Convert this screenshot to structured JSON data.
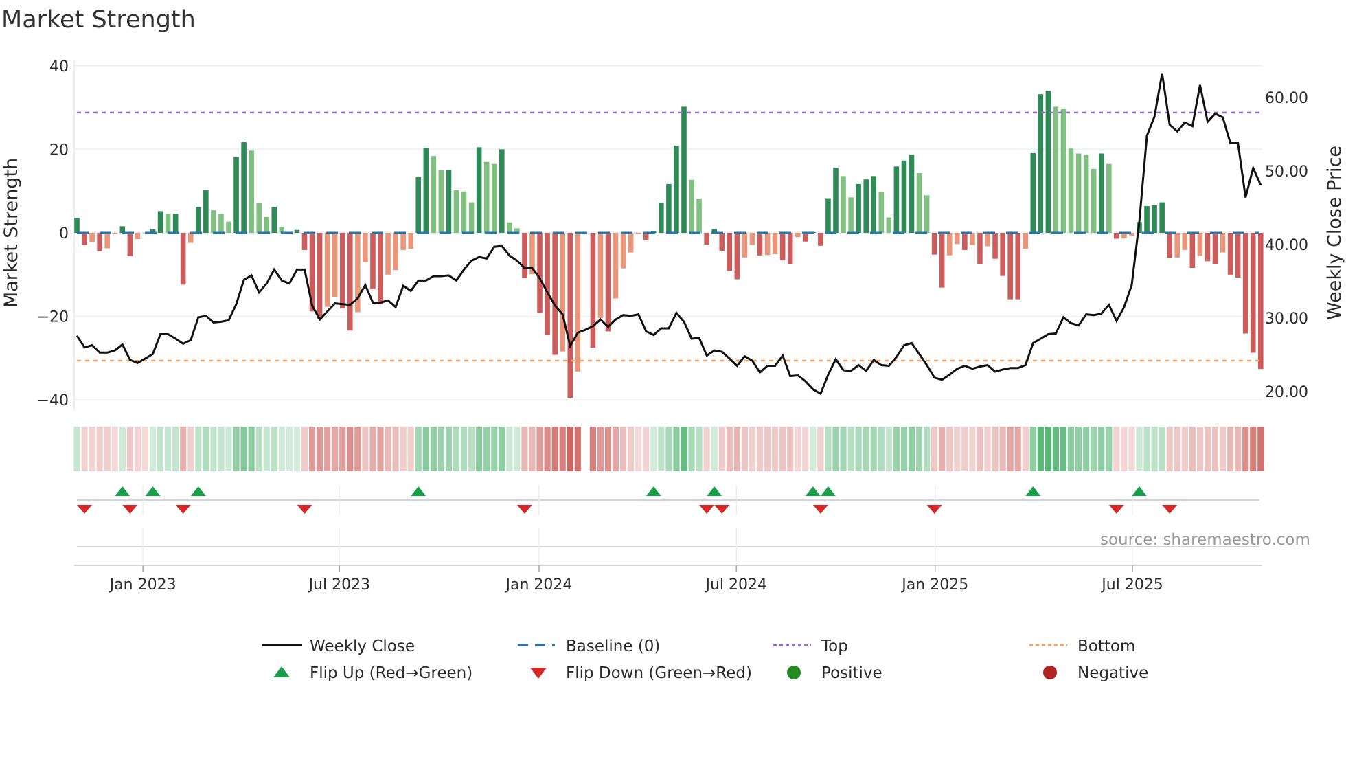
{
  "chart_data": {
    "type": "bar",
    "title": "Market Strength",
    "ylabel": "Market Strength",
    "y2label": "Weekly Close Price",
    "ylim": [
      -42,
      40
    ],
    "y2lim": [
      18.7,
      65
    ],
    "y_ticks": [
      {
        "value": 40,
        "label": "40"
      },
      {
        "value": 20,
        "label": "20"
      },
      {
        "value": 0,
        "label": "0"
      },
      {
        "value": -20,
        "label": "−20"
      },
      {
        "value": -40,
        "label": "−40"
      }
    ],
    "y2_ticks": [
      {
        "value": 60,
        "label": "60.00"
      },
      {
        "value": 50,
        "label": "50.00"
      },
      {
        "value": 40,
        "label": "40.00"
      },
      {
        "value": 30,
        "label": "30.00"
      },
      {
        "value": 20,
        "label": "20.00"
      }
    ],
    "x_ticks": [
      {
        "week_index": 8.7,
        "label": "Jan 2023"
      },
      {
        "week_index": 34.6,
        "label": "Jul 2023"
      },
      {
        "week_index": 60.9,
        "label": "Jan 2024"
      },
      {
        "week_index": 86.9,
        "label": "Jul 2024"
      },
      {
        "week_index": 113.1,
        "label": "Jan 2025"
      },
      {
        "week_index": 139.1,
        "label": "Jul 2025"
      }
    ],
    "reference_lines": {
      "top": 28.8,
      "bottom": -30.6,
      "baseline": 0
    },
    "strength": [
      3.6,
      -2.9,
      -2.2,
      -4.4,
      -3.7,
      -0.3,
      1.6,
      -5.6,
      -1.5,
      -0.1,
      0.9,
      5.2,
      4.5,
      4.6,
      -12.4,
      -2.4,
      6.2,
      10.2,
      5.4,
      4.5,
      2.7,
      18.2,
      21.7,
      19.7,
      7.1,
      3.8,
      6.2,
      1.4,
      0.2,
      0.7,
      -4.1,
      -18.8,
      -20.7,
      -17.7,
      -15.3,
      -18.1,
      -23.4,
      -19,
      -7,
      -13.5,
      -17.1,
      -10,
      -8.9,
      -4.1,
      -3.8,
      13.4,
      20.4,
      18.4,
      15,
      15,
      10.2,
      9.9,
      7.3,
      20.5,
      17,
      16.5,
      20,
      2.5,
      1.1,
      -10.8,
      -9.9,
      -19.2,
      -24.5,
      -29.2,
      -28.4,
      -39.5,
      -33.2,
      null,
      -27.5,
      -20.4,
      -23.6,
      -15.7,
      -8.5,
      -4.7,
      -0.3,
      -1.7,
      0.5,
      7.2,
      11.7,
      20.9,
      30.2,
      12.7,
      8.2,
      -2.8,
      0.9,
      -4.3,
      -9.1,
      -11.1,
      -5.9,
      -2.9,
      -5.4,
      -5.3,
      -5.1,
      -6.6,
      -7.4,
      -1,
      -2.1,
      0.2,
      -3.1,
      8.3,
      15.6,
      13.6,
      8.5,
      11.7,
      12.8,
      13.6,
      9.8,
      3.7,
      15.9,
      17.3,
      18.7,
      14.3,
      9,
      -5.2,
      -13.1,
      -5.4,
      -2.7,
      -4.1,
      -2.9,
      -7.4,
      -3.2,
      -6.2,
      -10.3,
      -15.9,
      -15.9,
      -3.8,
      19.1,
      33.2,
      34,
      30.2,
      29.8,
      20.2,
      19,
      18.6,
      15.3,
      19,
      16.5,
      -1.4,
      -1.3,
      -0.7,
      2.6,
      6.4,
      6.6,
      7.3,
      -6,
      -5.9,
      -4.1,
      -8.4,
      -5.5,
      -6.8,
      -7.4,
      -4.7,
      -10,
      -10.7,
      -24.1,
      -28.7,
      -32.6
    ],
    "weekly_close": [
      27.6,
      26.0,
      26.3,
      25.3,
      25.3,
      25.6,
      26.4,
      24.3,
      23.9,
      24.5,
      25.1,
      27.8,
      27.8,
      27.2,
      26.5,
      27.0,
      30.1,
      30.3,
      29.4,
      29.5,
      29.7,
      31.9,
      35.2,
      35.8,
      33.5,
      34.7,
      36.6,
      35.1,
      34.7,
      36.6,
      36.6,
      31.7,
      29.8,
      30.9,
      32.0,
      31.9,
      31.8,
      32.7,
      34.5,
      32.1,
      32.1,
      32.4,
      31.5,
      34.4,
      33.7,
      35.1,
      35.1,
      35.7,
      35.7,
      35.8,
      35.1,
      36.6,
      37.8,
      38.3,
      38.1,
      39.7,
      39.8,
      38.5,
      37.8,
      36.8,
      36.8,
      35.4,
      33.5,
      31.7,
      30.5,
      26.2,
      28.0,
      28.4,
      28.9,
      29.8,
      28.8,
      29.8,
      30.4,
      30.3,
      30.5,
      28.2,
      27.7,
      28.6,
      28.6,
      30.7,
      29.5,
      27.2,
      27.3,
      24.9,
      25.6,
      25.4,
      24.5,
      23.5,
      24.8,
      24.2,
      22.6,
      23.5,
      23.5,
      24.9,
      22.1,
      22.2,
      21.4,
      20.3,
      19.7,
      22.3,
      24.4,
      22.9,
      22.8,
      23.6,
      22.8,
      24.3,
      23.6,
      23.5,
      24.7,
      26.3,
      26.6,
      25.1,
      23.6,
      21.9,
      21.6,
      22.3,
      23.1,
      23.5,
      23.1,
      23.4,
      23.6,
      22.7,
      23.0,
      23.2,
      23.2,
      23.6,
      26.6,
      27.2,
      27.8,
      27.9,
      30.1,
      29.3,
      29.0,
      30.5,
      30.4,
      30.6,
      31.8,
      29.6,
      31.5,
      34.5,
      43.1,
      54.8,
      57.4,
      63.3,
      56.3,
      55.4,
      56.6,
      56.1,
      61.7,
      56.7,
      57.8,
      57.3,
      53.8,
      53.8,
      46.4,
      50.4,
      48.1
    ],
    "legend": {
      "placement": "bottom-center",
      "weekly_close": "Weekly Close",
      "baseline": "Baseline (0)",
      "top": "Top",
      "bottom": "Bottom",
      "flip_up": "Flip Up (Red→Green)",
      "flip_down": "Flip Down (Green→Red)",
      "positive": "Positive",
      "negative": "Negative"
    },
    "source": "source: sharemaestro.com"
  },
  "colors": {
    "pos_strong": "#2e8b57",
    "pos_weak": "#80c080",
    "neg_strong": "#cd5c5c",
    "neg_weak": "#e9967a",
    "line": "#111111",
    "baseline": "#1f77b4",
    "top": "#9b6ad6",
    "bottom": "#f4a460",
    "flip_up": "#1a9e4a",
    "flip_down": "#d62728",
    "legend_positive": "#228b22",
    "legend_negative": "#b22222"
  }
}
